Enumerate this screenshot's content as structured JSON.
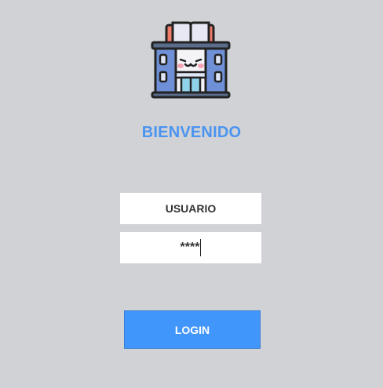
{
  "logo": {
    "icon": "school-building-book-icon"
  },
  "title": "BIENVENIDO",
  "form": {
    "username_value": "USUARIO",
    "password_value": "****",
    "login_label": "LOGIN"
  },
  "colors": {
    "background": "#d1d2d6",
    "title": "#4b94f0",
    "button": "#4196fb",
    "input_bg": "#ffffff"
  }
}
